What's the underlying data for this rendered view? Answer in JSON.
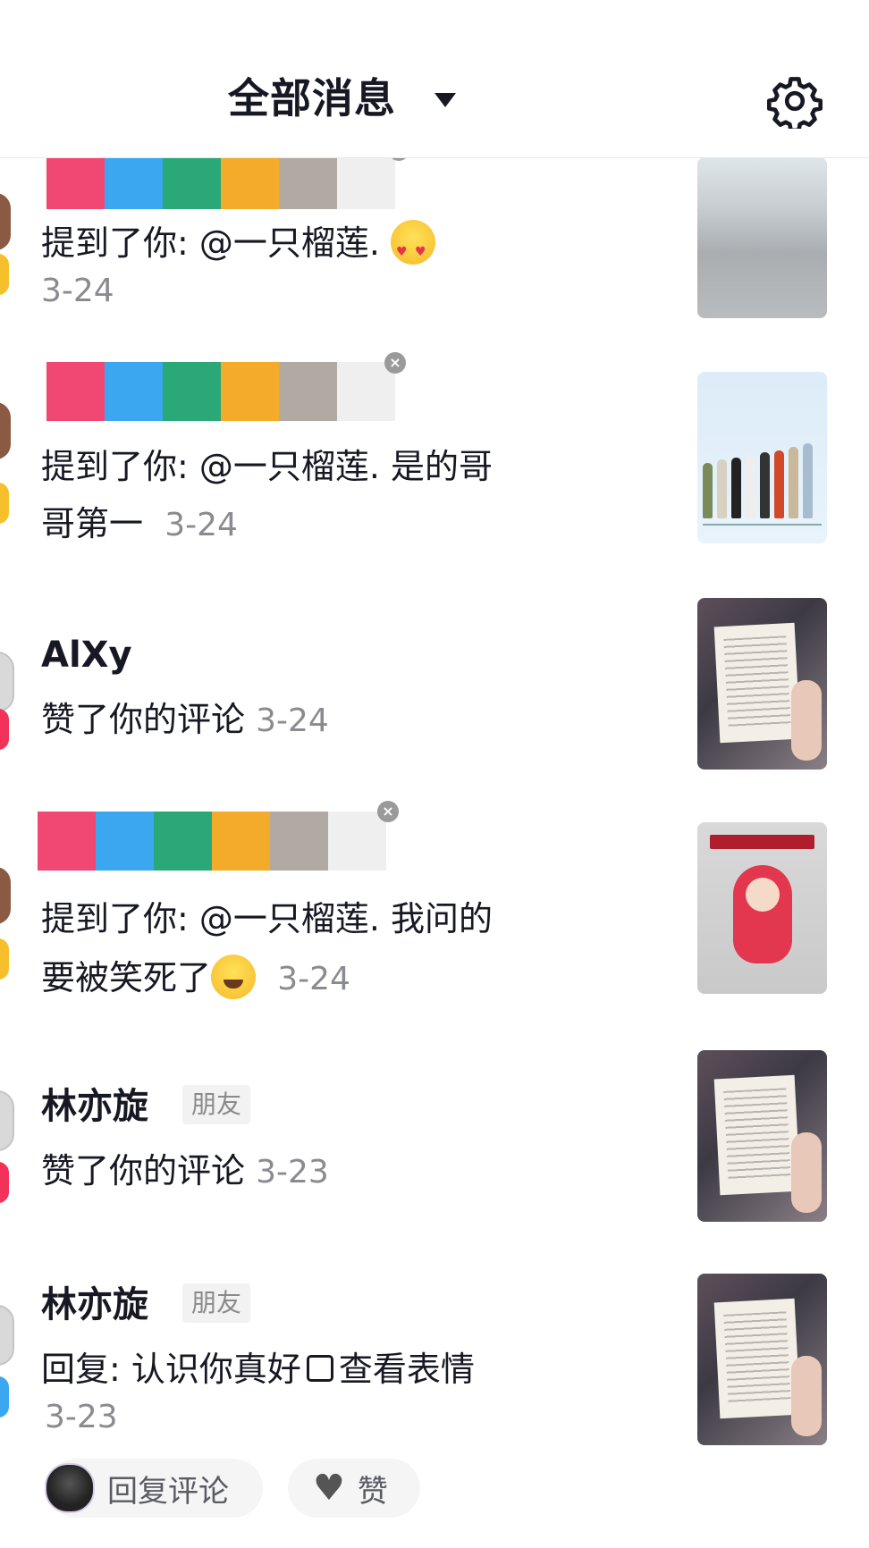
{
  "header": {
    "title": "全部消息",
    "settings_icon": "gear-icon"
  },
  "censor_colors": [
    "#f04873",
    "#3aa7f0",
    "#2aa877",
    "#f4ab2a",
    "#b0aaa2",
    "#efefef"
  ],
  "messages": [
    {
      "name": "",
      "name_censored": true,
      "text": "提到了你: @一只榴莲. ",
      "emoji": "heart-eyes-emoji",
      "date": "3-24",
      "thumb": "sea-thumbnail"
    },
    {
      "name": "",
      "name_censored": true,
      "text_line1": "提到了你: @一只榴莲. 是的哥",
      "text_line2": "哥第一",
      "date": "3-24",
      "thumb": "lineup-thumbnail"
    },
    {
      "name": "AlXy",
      "text": "赞了你的评论 ",
      "date": "3-24",
      "thumb": "book-thumbnail"
    },
    {
      "name": "",
      "name_censored": true,
      "text_line1": "提到了你: @一只榴莲. 我问的",
      "text_line2": "要被笑死了",
      "emoji": "laugh-cry-emoji",
      "date": "3-24",
      "thumb": "doll-thumbnail"
    },
    {
      "name": "林亦旋",
      "tag": "朋友",
      "text": "赞了你的评论 ",
      "date": "3-23",
      "thumb": "book-thumbnail"
    },
    {
      "name": "林亦旋",
      "tag": "朋友",
      "text_prefix": "回复: 认识你真好",
      "text_suffix": "查看表情",
      "date": "3-23",
      "thumb": "book-thumbnail"
    }
  ],
  "actions": {
    "reply_label": "回复评论",
    "like_label": "赞"
  }
}
